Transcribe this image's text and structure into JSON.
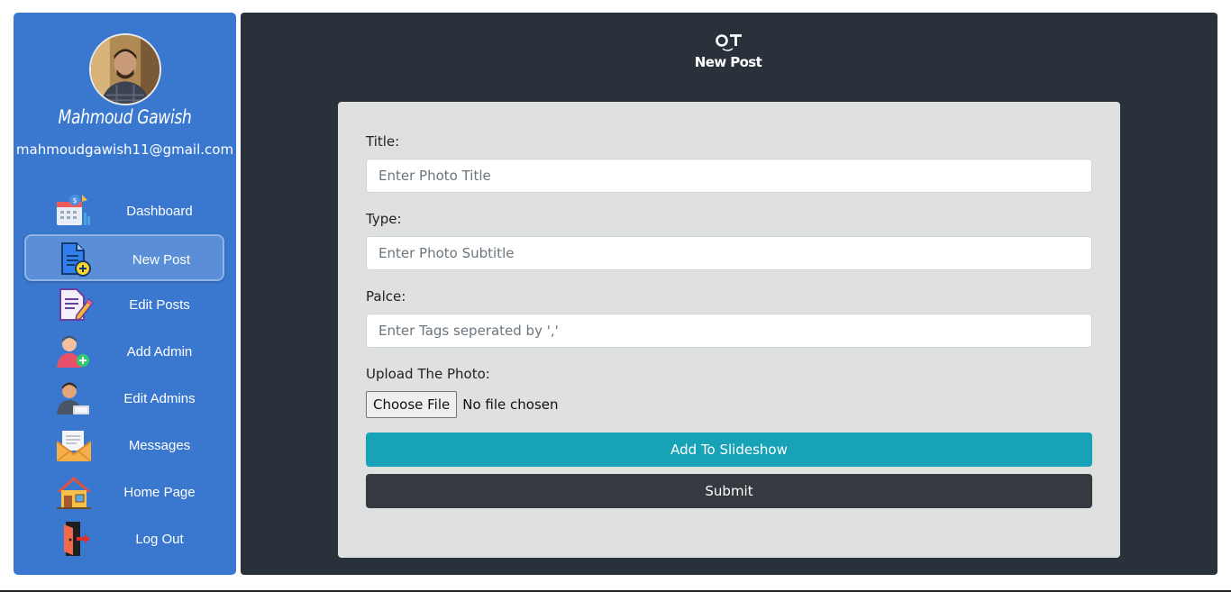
{
  "profile": {
    "name": "Mahmoud Gawish",
    "email": "mahmoudgawish11@gmail.com"
  },
  "sidebar": {
    "items": [
      {
        "label": "Dashboard",
        "icon": "dashboard-icon",
        "active": false
      },
      {
        "label": "New Post",
        "icon": "new-post-icon",
        "active": true
      },
      {
        "label": "Edit Posts",
        "icon": "edit-posts-icon",
        "active": false
      },
      {
        "label": "Add Admin",
        "icon": "add-admin-icon",
        "active": false
      },
      {
        "label": "Edit Admins",
        "icon": "edit-admins-icon",
        "active": false
      },
      {
        "label": "Messages",
        "icon": "messages-icon",
        "active": false
      },
      {
        "label": "Home Page",
        "icon": "home-icon",
        "active": false
      },
      {
        "label": "Log Out",
        "icon": "logout-icon",
        "active": false
      }
    ]
  },
  "header": {
    "logo_text": "OT",
    "title": "New Post"
  },
  "form": {
    "title_label": "Title:",
    "title_placeholder": "Enter Photo Title",
    "type_label": "Type:",
    "type_placeholder": "Enter Photo Subtitle",
    "place_label": "Palce:",
    "place_placeholder": "Enter Tags seperated by ','",
    "upload_label": "Upload The Photo:",
    "choose_file_label": "Choose File",
    "file_status": "No file chosen",
    "slideshow_button": "Add To Slideshow",
    "submit_button": "Submit"
  },
  "colors": {
    "sidebar_bg": "#3a78cf",
    "main_bg": "#29323b",
    "card_bg": "#dfe0e0",
    "slideshow_button": "#17a2b8",
    "submit_button": "#343a40"
  }
}
